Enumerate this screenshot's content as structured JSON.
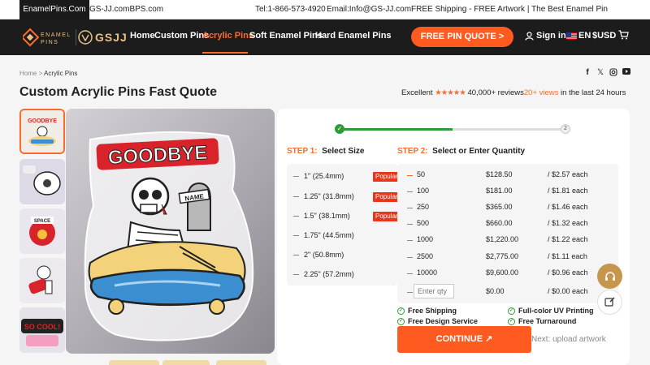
{
  "topbar": {
    "tab1": "EnamelPins.Com",
    "tab2": "GS-JJ.comBPS.com",
    "tel": "Tel:1-866-573-4920",
    "email": "Email:Info@GS-JJ.com",
    "promo": "FREE Shipping - FREE Artwork | The Best Enamel Pin Manufacturer"
  },
  "nav": {
    "logo_brand": "GSJJ",
    "items": [
      "Home",
      "Custom Pins",
      "Acrylic Pins",
      "Soft Enamel Pins",
      "Hard Enamel Pins"
    ],
    "active_index": 2,
    "quote_button": "FREE PIN QUOTE >",
    "signin": "Sign in",
    "lang": "EN",
    "currency": "$USD"
  },
  "breadcrumb": {
    "home": "Home",
    "sep": " > ",
    "current": "Acrylic Pins"
  },
  "page_title": "Custom Acrylic Pins Fast Quote",
  "reviews": {
    "prefix": "Excellent",
    "stars": "★★★★★",
    "count": "40,000+ reviews",
    "views": "20+ views",
    "suffix": " in the last 24 hours"
  },
  "socials": [
    "facebook-icon",
    "x-icon",
    "instagram-icon",
    "youtube-icon"
  ],
  "main_image": {
    "text": "GOODBYE",
    "tag": "NAME"
  },
  "progress": {
    "step1": "✓",
    "step2": "2",
    "fraction": 0.5
  },
  "step1": {
    "num": "STEP 1:",
    "label": "Select Size"
  },
  "step2": {
    "num": "STEP 2:",
    "label": "Select or Enter Quantity"
  },
  "sizes": [
    {
      "label": "1\" (25.4mm)",
      "badge": "Popular",
      "selected": true
    },
    {
      "label": "1.25\" (31.8mm)",
      "badge": "Popular",
      "selected": false
    },
    {
      "label": "1.5\" (38.1mm)",
      "badge": "Popular",
      "selected": false
    },
    {
      "label": "1.75\" (44.5mm)",
      "badge": "",
      "selected": false
    },
    {
      "label": "2\" (50.8mm)",
      "badge": "",
      "selected": false
    },
    {
      "label": "2.25\" (57.2mm)",
      "badge": "",
      "selected": false
    }
  ],
  "quantities": [
    {
      "qty": "50",
      "price": "$128.50",
      "unit": "/ $2.57 each",
      "selected": true
    },
    {
      "qty": "100",
      "price": "$181.00",
      "unit": "/ $1.81 each",
      "selected": false
    },
    {
      "qty": "250",
      "price": "$365.00",
      "unit": "/ $1.46 each",
      "selected": false
    },
    {
      "qty": "500",
      "price": "$660.00",
      "unit": "/ $1.32 each",
      "selected": false
    },
    {
      "qty": "1000",
      "price": "$1,220.00",
      "unit": "/ $1.22 each",
      "selected": false
    },
    {
      "qty": "2500",
      "price": "$2,775.00",
      "unit": "/ $1.11 each",
      "selected": false
    },
    {
      "qty": "10000",
      "price": "$9,600.00",
      "unit": "/ $0.96 each",
      "selected": false
    }
  ],
  "custom_qty": {
    "placeholder": "Enter qty",
    "price": "$0.00",
    "unit": "/ $0.00 each"
  },
  "features": [
    "Free Shipping",
    "Full-color UV Printing",
    "Free Design Service",
    "Free Turnaround"
  ],
  "continue_button": "CONTINUE ↗",
  "next_text": "Next: upload artwork",
  "colors": {
    "accent": "#ff5a1f",
    "nav_bg": "#1c1c1c",
    "green": "#2e9b3a",
    "badge": "#e8361b",
    "fab": "#c6964d"
  }
}
